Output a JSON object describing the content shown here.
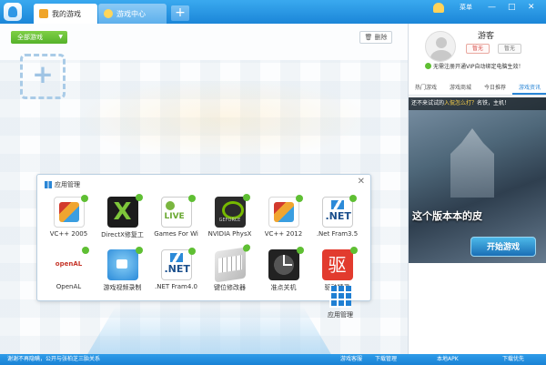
{
  "titlebar": {
    "tabs": [
      {
        "label": "我的游戏",
        "icon": "game-folder-icon"
      },
      {
        "label": "游戏中心",
        "icon": "game-center-icon"
      }
    ],
    "add_tab": "+",
    "menu_label": "菜单",
    "min": "—",
    "max": "□",
    "close": "✕"
  },
  "main": {
    "all_games": "全部游戏",
    "all_games_caret": "▼",
    "delete_label": "删除",
    "delete_icon": "trash-icon",
    "add_game": "+"
  },
  "app_manager": {
    "title": "应用管理",
    "close": "✕",
    "apps": [
      {
        "label": "VC++ 2005",
        "icon": "vc-redist-icon"
      },
      {
        "label": "DirectX修复工",
        "icon": "directx-icon"
      },
      {
        "label": "Games For Wi",
        "icon": "games-for-windows-icon"
      },
      {
        "label": "NVIDIA PhysX",
        "icon": "nvidia-icon"
      },
      {
        "label": "VC++ 2012",
        "icon": "vc-redist-icon"
      },
      {
        "label": ".Net Fram3.5",
        "icon": "dotnet-icon"
      },
      {
        "label": "OpenAL",
        "icon": "openal-icon"
      },
      {
        "label": "游戏视频录制",
        "icon": "video-record-icon"
      },
      {
        "label": ".NET Fram4.0",
        "icon": "dotnet-icon"
      },
      {
        "label": "键位修改器",
        "icon": "keyboard-icon"
      },
      {
        "label": "准点关机",
        "icon": "clock-icon"
      },
      {
        "label": "驱动精灵",
        "icon": "driver-icon"
      }
    ],
    "launcher_label": "应用管理"
  },
  "right_panel": {
    "username": "游客",
    "vip_badges": [
      "暂无",
      "暂无"
    ],
    "vip_tip": "无需注册开通VIP自动绑定电脑生效！",
    "tabs": [
      "热门游戏",
      "游戏商城",
      "今日推荐",
      "游戏资讯"
    ],
    "active_tab": 3,
    "banner": {
      "top_text_prefix": "还不来试试的",
      "top_text_highlight": "入侃怎么打？",
      "top_text_suffix": "名铁，主机！",
      "slogan": "这个版本本的皮",
      "play_button": "开始游戏"
    }
  },
  "status_bar": {
    "news": "谢谢不再隐瞒，公开与张柏芝三胎关系",
    "service": "游戏客服",
    "download": "下载管理",
    "apk": "本地APK",
    "download_fast": "下载优先"
  },
  "colors": {
    "titlebar": "#1b86d8",
    "accent_green": "#55b22a",
    "active_tab_text": "#2a86d6"
  }
}
